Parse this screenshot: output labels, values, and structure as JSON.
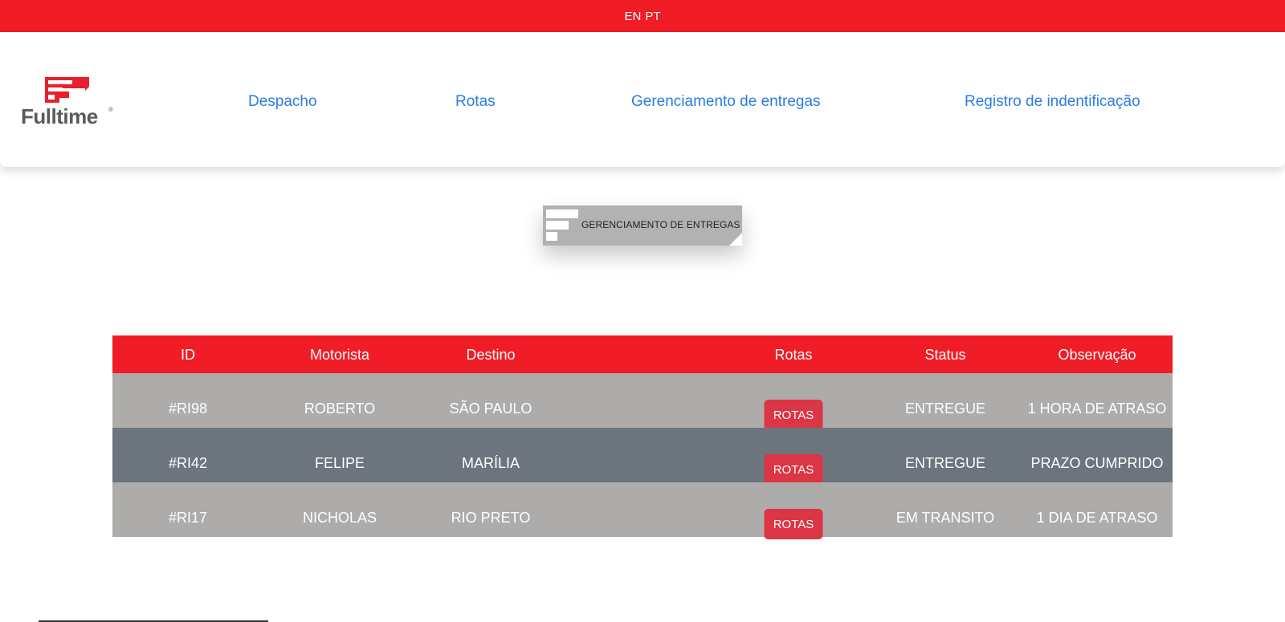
{
  "language_bar": {
    "en": "EN",
    "pt": "PT"
  },
  "logo": {
    "text": "Fulltime",
    "reg": "®"
  },
  "nav": {
    "despacho": "Despacho",
    "rotas": "Rotas",
    "gerenciamento": "Gerenciamento de entregas",
    "registro": "Registro de indentificação"
  },
  "banner": {
    "label": "GERENCIAMENTO DE ENTREGAS"
  },
  "table": {
    "headers": {
      "id": "ID",
      "motorista": "Motorista",
      "destino": "Destino",
      "rotas": "Rotas",
      "status": "Status",
      "observacao": "Observação"
    },
    "rows": [
      {
        "id": "#RI98",
        "motorista": "ROBERTO",
        "destino": "SÃO PAULO",
        "rotas_button": "ROTAS",
        "status": "ENTREGUE",
        "observacao": "1 HORA DE ATRASO"
      },
      {
        "id": "#RI42",
        "motorista": "FELIPE",
        "destino": "MARÍLIA",
        "rotas_button": "ROTAS",
        "status": "ENTREGUE",
        "observacao": "PRAZO CUMPRIDO"
      },
      {
        "id": "#RI17",
        "motorista": "NICHOLAS",
        "destino": "RIO PRETO",
        "rotas_button": "ROTAS",
        "status": "EM TRANSITO",
        "observacao": "1 DIA DE ATRASO"
      }
    ]
  },
  "colors": {
    "brand_red": "#f01c26",
    "button_red": "#dc3545",
    "link_blue": "#2a7de1",
    "row_light": "#adacab",
    "row_dark": "#6c757d"
  }
}
